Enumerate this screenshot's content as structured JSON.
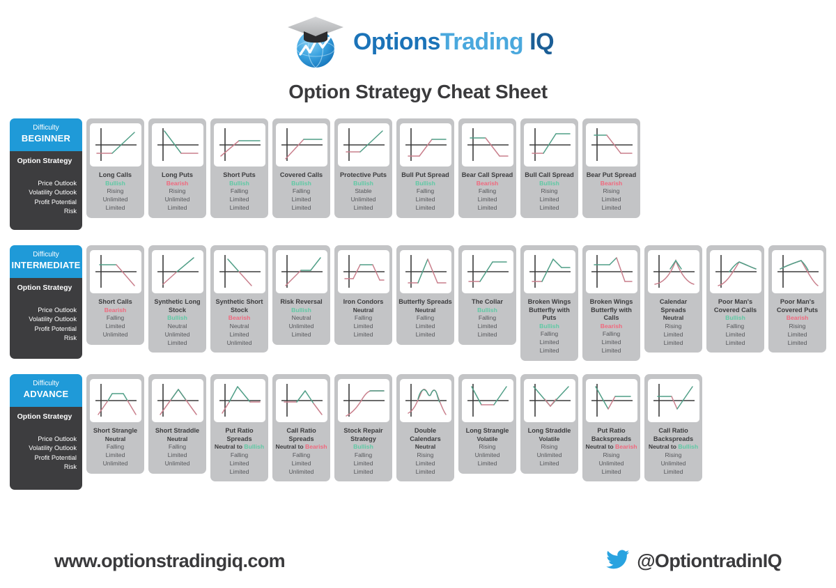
{
  "header": {
    "logo": {
      "part1": "Options",
      "part2": "Trading",
      "part3": "IQ",
      "icon": "graduation-globe-logo"
    },
    "title": "Option Strategy Cheat Sheet"
  },
  "labels": {
    "difficulty_caption": "Difficulty",
    "option_strategy": "Option Strategy",
    "attributes": [
      "Price Outlook",
      "Volatility Outlook",
      "Profit Potential",
      "Risk"
    ]
  },
  "colors": {
    "difficulty_blue": "#1f9ad8",
    "panel_dark": "#3d3d3f",
    "card_grey": "#c3c4c6",
    "bullish_green": "#5fc9a4",
    "bearish_red": "#f0697e",
    "neutral_dark": "#3c3c3e",
    "chart_profit": "#4f9e86",
    "chart_loss": "#c97f8c",
    "chart_axis": "#3a3a3a"
  },
  "rows": [
    {
      "level": "BEGINNER",
      "cards": [
        {
          "name": "Long Calls",
          "outlook": "Bullish",
          "outlook_type": "bullish",
          "volatility": "Rising",
          "profit": "Unlimited",
          "risk": "Limited",
          "payoff": "long-call"
        },
        {
          "name": "Long Puts",
          "outlook": "Bearish",
          "outlook_type": "bearish",
          "volatility": "Rising",
          "profit": "Unlimited",
          "risk": "Limited",
          "payoff": "long-put"
        },
        {
          "name": "Short Puts",
          "outlook": "Bullish",
          "outlook_type": "bullish",
          "volatility": "Falling",
          "profit": "Limited",
          "risk": "Limited",
          "payoff": "short-put"
        },
        {
          "name": "Covered Calls",
          "outlook": "Bullish",
          "outlook_type": "bullish",
          "volatility": "Falling",
          "profit": "Limited",
          "risk": "Limited",
          "payoff": "covered-call"
        },
        {
          "name": "Protective Puts",
          "outlook": "Bullish",
          "outlook_type": "bullish",
          "volatility": "Stable",
          "profit": "Unlimited",
          "risk": "Limited",
          "payoff": "protective-put"
        },
        {
          "name": "Bull Put Spread",
          "outlook": "Bullish",
          "outlook_type": "bullish",
          "volatility": "Falling",
          "profit": "Limited",
          "risk": "Limited",
          "payoff": "bull-put-spread"
        },
        {
          "name": "Bear Call Spread",
          "outlook": "Bearish",
          "outlook_type": "bearish",
          "volatility": "Falling",
          "profit": "Limited",
          "risk": "Limited",
          "payoff": "bear-call-spread"
        },
        {
          "name": "Bull Call Spread",
          "outlook": "Bullish",
          "outlook_type": "bullish",
          "volatility": "Rising",
          "profit": "Limited",
          "risk": "Limited",
          "payoff": "bull-call-spread"
        },
        {
          "name": "Bear Put Spread",
          "outlook": "Bearish",
          "outlook_type": "bearish",
          "volatility": "Rising",
          "profit": "Limited",
          "risk": "Limited",
          "payoff": "bear-put-spread"
        }
      ]
    },
    {
      "level": "INTERMEDIATE",
      "cards": [
        {
          "name": "Short Calls",
          "outlook": "Bearish",
          "outlook_type": "bearish",
          "volatility": "Falling",
          "profit": "Limited",
          "risk": "Unlimited",
          "payoff": "short-call"
        },
        {
          "name": "Synthetic Long Stock",
          "outlook": "Bullish",
          "outlook_type": "bullish",
          "volatility": "Neutral",
          "profit": "Unlimited",
          "risk": "Limited",
          "payoff": "synthetic-long"
        },
        {
          "name": "Synthetic Short Stock",
          "outlook": "Bearish",
          "outlook_type": "bearish",
          "volatility": "Neutral",
          "profit": "Limited",
          "risk": "Unlimited",
          "payoff": "synthetic-short"
        },
        {
          "name": "Risk Reversal",
          "outlook": "Bullish",
          "outlook_type": "bullish",
          "volatility": "Neutral",
          "profit": "Unlimited",
          "risk": "Limited",
          "payoff": "risk-reversal"
        },
        {
          "name": "Iron Condors",
          "outlook": "Neutral",
          "outlook_type": "neutral",
          "volatility": "Falling",
          "profit": "Limited",
          "risk": "Limited",
          "payoff": "iron-condor"
        },
        {
          "name": "Butterfly Spreads",
          "outlook": "Neutral",
          "outlook_type": "neutral",
          "volatility": "Falling",
          "profit": "Limited",
          "risk": "Limited",
          "payoff": "butterfly"
        },
        {
          "name": "The Collar",
          "outlook": "Bullish",
          "outlook_type": "bullish",
          "volatility": "Falling",
          "profit": "Limited",
          "risk": "Limited",
          "payoff": "collar"
        },
        {
          "name": "Broken Wings Butterfly with Puts",
          "outlook": "Bullish",
          "outlook_type": "bullish",
          "volatility": "Falling",
          "profit": "Limited",
          "risk": "Limited",
          "payoff": "bwb-puts"
        },
        {
          "name": "Broken Wings Butterfly with Calls",
          "outlook": "Bearish",
          "outlook_type": "bearish",
          "volatility": "Falling",
          "profit": "Limited",
          "risk": "Limited",
          "payoff": "bwb-calls"
        },
        {
          "name": "Calendar Spreads",
          "outlook": "Neutral",
          "outlook_type": "neutral",
          "volatility": "Rising",
          "profit": "Limited",
          "risk": "Limited",
          "payoff": "calendar"
        },
        {
          "name": "Poor Man's Covered Calls",
          "outlook": "Bullish",
          "outlook_type": "bullish",
          "volatility": "Falling",
          "profit": "Limited",
          "risk": "Limited",
          "payoff": "pmcc"
        },
        {
          "name": "Poor Man's Covered Puts",
          "outlook": "Bearish",
          "outlook_type": "bearish",
          "volatility": "Rising",
          "profit": "Limited",
          "risk": "Limited",
          "payoff": "pmcp"
        }
      ]
    },
    {
      "level": "ADVANCE",
      "cards": [
        {
          "name": "Short Strangle",
          "outlook": "Neutral",
          "outlook_type": "neutral",
          "volatility": "Falling",
          "profit": "Limited",
          "risk": "Unlimited",
          "payoff": "short-strangle"
        },
        {
          "name": "Short Straddle",
          "outlook": "Neutral",
          "outlook_type": "neutral",
          "volatility": "Falling",
          "profit": "Limited",
          "risk": "Unlimited",
          "payoff": "short-straddle"
        },
        {
          "name": "Put Ratio Spreads",
          "outlook": "Neutral to Bullish",
          "outlook_type": "mixed-bullish",
          "outlook_pre": "Neutral to ",
          "outlook_post": "Bullish",
          "volatility": "Falling",
          "profit": "Limited",
          "risk": "Limited",
          "payoff": "put-ratio-spread"
        },
        {
          "name": "Call Ratio Spreads",
          "outlook": "Neutral to Bearish",
          "outlook_type": "mixed-bearish",
          "outlook_pre": "Neutral to ",
          "outlook_post": "Bearish",
          "volatility": "Falling",
          "profit": "Limited",
          "risk": "Unlimited",
          "payoff": "call-ratio-spread"
        },
        {
          "name": "Stock Repair Strategy",
          "outlook": "Bullish",
          "outlook_type": "bullish",
          "volatility": "Falling",
          "profit": "Limited",
          "risk": "Limited",
          "payoff": "stock-repair"
        },
        {
          "name": "Double Calendars",
          "outlook": "Neutral",
          "outlook_type": "neutral",
          "volatility": "Rising",
          "profit": "Limited",
          "risk": "Limited",
          "payoff": "double-calendar"
        },
        {
          "name": "Long Strangle",
          "outlook": "Volatile",
          "outlook_type": "volatile",
          "volatility": "Rising",
          "profit": "Unlimited",
          "risk": "Limited",
          "payoff": "long-strangle"
        },
        {
          "name": "Long Straddle",
          "outlook": "Volatile",
          "outlook_type": "volatile",
          "volatility": "Rising",
          "profit": "Unlimited",
          "risk": "Limited",
          "payoff": "long-straddle"
        },
        {
          "name": "Put Ratio Backspreads",
          "outlook": "Neutral to Bearish",
          "outlook_type": "mixed-bearish",
          "outlook_pre": "Neutral to ",
          "outlook_post": "Bearish",
          "volatility": "Rising",
          "profit": "Unlimited",
          "risk": "Limited",
          "payoff": "put-backspread"
        },
        {
          "name": "Call Ratio Backspreads",
          "outlook": "Neutral to Bullish",
          "outlook_type": "mixed-bullish",
          "outlook_pre": "Neutral to ",
          "outlook_post": "Bullish",
          "volatility": "Rising",
          "profit": "Unlimited",
          "risk": "Limited",
          "payoff": "call-backspread"
        }
      ]
    }
  ],
  "footer": {
    "website": "www.optionstradingiq.com",
    "twitter_handle": "@OptiontradinIQ",
    "twitter_icon": "twitter-bird-icon"
  }
}
